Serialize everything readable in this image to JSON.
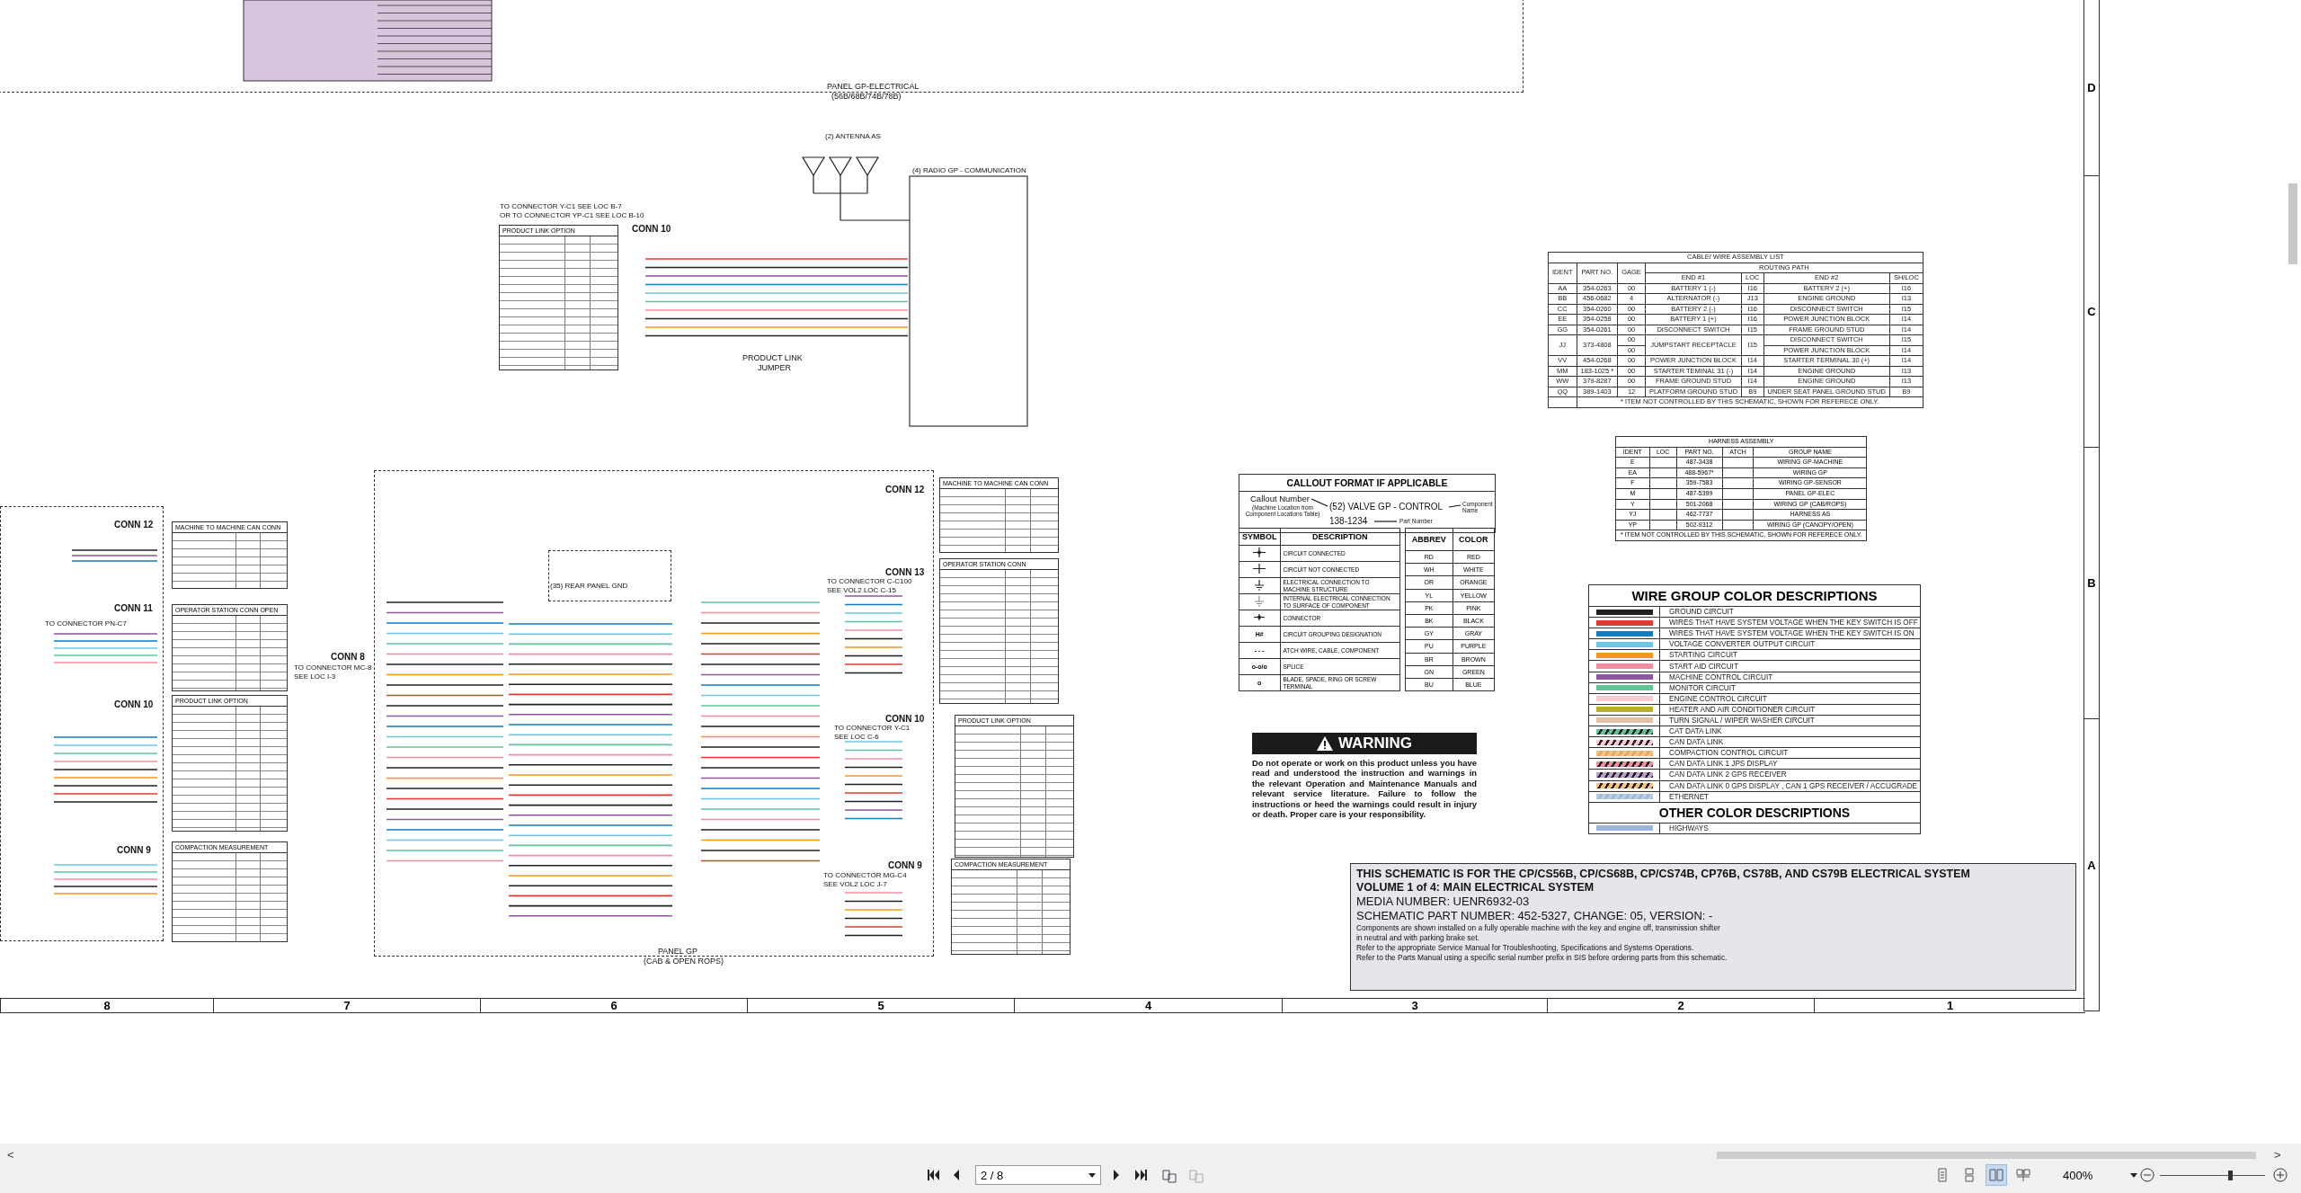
{
  "sheet": {
    "labels": [
      "PANEL GP-ELECTRICAL",
      "(56B/68B/74B/78B)",
      "(2) ANTENNA AS",
      "(4) RADIO GP - COMMUNICATION",
      "TO CONNECTOR Y-C1 SEE LOC B-7",
      "OR TO CONNECTOR YP-C1 SEE LOC B-10",
      "CONN 10",
      "PRODUCT LINK",
      "JUMPER",
      "CONN 12",
      "CONN 11",
      "TO CONNECTOR PN-C7",
      "CONN 10",
      "CONN 9",
      "CONN 8",
      "TO CONNECTOR MC-8",
      "SEE LOC I-3",
      "CONN 12",
      "CONN 13",
      "TO CONNECTOR C-C100",
      "SEE VOL2 LOC C-15",
      "CONN 10",
      "TO CONNECTOR Y-C1",
      "SEE LOC C-6",
      "CONN 9",
      "TO CONNECTOR MG-C4",
      "SEE VOL2 LOC J-7",
      "PANEL GP",
      "(CAB & OPEN ROPS)",
      "(35) REAR PANEL GND"
    ],
    "connector_tables": [
      "PRODUCT LINK OPTION",
      "MACHINE TO MACHINE CAN CONN",
      "OPERATOR STATION CONN OPEN",
      "PRODUCT LINK OPTION",
      "COMPACTION MEASUREMENT",
      "MACHINE TO MACHINE CAN CONN",
      "OPERATOR STATION CONN",
      "PRODUCT LINK OPTION",
      "COMPACTION MEASUREMENT"
    ],
    "row_letters": [
      "D",
      "C",
      "B",
      "A"
    ],
    "column_numbers": [
      "8",
      "7",
      "6",
      "5",
      "4",
      "3",
      "2",
      "1"
    ],
    "cable_list": {
      "title": "CABLE/ WIRE ASSEMBLY LIST",
      "columns": [
        "IDENT",
        "PART NO.",
        "GAGE"
      ],
      "group": "ROUTING PATH",
      "subcolumns": [
        "END #1",
        "LOC",
        "END #2",
        "SH/LOC"
      ],
      "rows": [
        {
          "kind": "full",
          "cells": [
            "AA",
            "354-0263",
            "00",
            "BATTERY 1 (-)",
            "I16",
            "BATTERY 2 (+)",
            "I16"
          ]
        },
        {
          "kind": "full",
          "cells": [
            "BB",
            "456-0682",
            "4",
            "ALTERNATOR (-)",
            "J13",
            "ENGINE GROUND",
            "I13"
          ]
        },
        {
          "kind": "full",
          "cells": [
            "CC",
            "354-0260",
            "00",
            "BATTERY 2 (-)",
            "I16",
            "DISCONNECT SWITCH",
            "I15"
          ]
        },
        {
          "kind": "full",
          "cells": [
            "EE",
            "354-0258",
            "00",
            "BATTERY 1 (+)",
            "I16",
            "POWER JUNCTION BLOCK",
            "I14"
          ]
        },
        {
          "kind": "full",
          "cells": [
            "GG",
            "354-0261",
            "00",
            "DISCONNECT SWITCH",
            "I15",
            "FRAME GROUND STUD",
            "I14"
          ]
        },
        {
          "kind": "full",
          "cells": [
            {
              "text": "JJ",
              "rowspan": 2
            },
            {
              "text": "373-4808",
              "rowspan": 2
            },
            "00",
            {
              "text": "JUMPSTART RECEPTACLE",
              "rowspan": 2
            },
            {
              "text": "I15",
              "rowspan": 2
            },
            "DISCONNECT SWITCH",
            "I15"
          ]
        },
        {
          "kind": "sub",
          "cells": [
            "00",
            "POWER JUNCTION BLOCK",
            "I14"
          ]
        },
        {
          "kind": "full",
          "cells": [
            "VV",
            "454-0268",
            "00",
            "POWER JUNCTION BLOCK",
            "I14",
            "STARTER TERMINAL 30 (+)",
            "I14"
          ]
        },
        {
          "kind": "full",
          "cells": [
            "MM",
            "183-1025 *",
            "00",
            "STARTER TEMINAL 31 (-)",
            "I14",
            "ENGINE GROUND",
            "I13"
          ]
        },
        {
          "kind": "full",
          "cells": [
            "WW",
            "379-8287",
            "00",
            "FRAME GROUND STUD",
            "I14",
            "ENGINE GROUND",
            "I13"
          ]
        },
        {
          "kind": "full",
          "cells": [
            "QQ",
            "389-1403",
            "12",
            "PLATFORM GROUND STUD",
            "B9",
            "UNDER SEAT PANEL GROUND STUD",
            "B9"
          ]
        }
      ],
      "footnote": "*  ITEM NOT CONTROLLED BY THIS SCHEMATIC, SHOWN FOR REFERECE ONLY."
    },
    "harness": {
      "title": "HARNESS ASSEMBLY",
      "columns": [
        "IDENT",
        "LOC",
        "PART NO.",
        "ATCH",
        "GROUP NAME"
      ],
      "rows": [
        [
          "E",
          "",
          "487-3438",
          "",
          "WIRING GP-MACHINE"
        ],
        [
          "EA",
          "",
          "488-5967*",
          "",
          "WIRING GP"
        ],
        [
          "F",
          "",
          "359-7583",
          "",
          "WIRING GP-SENSOR"
        ],
        [
          "M",
          "",
          "487-5399",
          "",
          "PANEL GP-ELEC"
        ],
        [
          "Y",
          "",
          "501-2068",
          "",
          "WIRING GP (CAB/ROPS)"
        ],
        [
          "YJ",
          "",
          "462-7737",
          "",
          "HARNESS AS"
        ],
        [
          "YP",
          "",
          "502-9312",
          "",
          "WIRING GP (CANOPY/OPEN)"
        ]
      ],
      "footnote": "*  ITEM NOT CONTROLLED BY THIS SCHEMATIC, SHOWN FOR REFERECE ONLY."
    },
    "callout": {
      "title": "CALLOUT FORMAT IF APPLICABLE",
      "callout_number": "Callout Number",
      "callout_hint": "(Machine Location from Component Locations Table)",
      "component": "(52) VALVE GP - CONTROL",
      "component_hint": "Component Name",
      "part": "138-1234",
      "part_hint": "Part Number"
    },
    "symbols": {
      "columns": [
        "SYMBOL",
        "DESCRIPTION"
      ],
      "rows": [
        {
          "kind": "dot-cross",
          "description": "CIRCUIT CONNECTED"
        },
        {
          "kind": "cross",
          "description": "CIRCUIT NOT CONNECTED"
        },
        {
          "kind": "ground",
          "description": "ELECTRICAL CONNECTION TO MACHINE STRUCTURE"
        },
        {
          "kind": "internal-ground",
          "description": "INTERNAL ELECTRICAL CONNECTION TO SURFACE OF COMPONENT"
        },
        {
          "kind": "connector",
          "description": "CONNECTOR"
        },
        {
          "kind": "text",
          "symbol": "H#",
          "description": "CIRCUIT GROUPING DESIGNATION"
        },
        {
          "kind": "text",
          "symbol": "- - -",
          "description": "ATCH WIRE, CABLE, COMPONENT"
        },
        {
          "kind": "text",
          "symbol": "o-o/o",
          "description": "SPLICE"
        },
        {
          "kind": "text",
          "symbol": "o",
          "description": "BLADE, SPADE, RING OR SCREW TERMINAL"
        }
      ]
    },
    "abbreviations": {
      "columns": [
        "ABBREV",
        "COLOR"
      ],
      "rows": [
        [
          "RD",
          "RED"
        ],
        [
          "WH",
          "WHITE"
        ],
        [
          "OR",
          "ORANGE"
        ],
        [
          "YL",
          "YELLOW"
        ],
        [
          "PK",
          "PINK"
        ],
        [
          "BK",
          "BLACK"
        ],
        [
          "GY",
          "GRAY"
        ],
        [
          "PU",
          "PURPLE"
        ],
        [
          "BR",
          "BROWN"
        ],
        [
          "GN",
          "GREEN"
        ],
        [
          "BU",
          "BLUE"
        ]
      ]
    },
    "warning": {
      "title": "WARNING",
      "text": "Do not operate or work on this product unless you have read and understood the instruction and warnings in the relevant Operation and Maintenance Manuals and relevant service literature. Failure to follow the instructions or heed the warnings could result in injury or death. Proper care is your responsibility."
    },
    "wire_groups": {
      "title": "WIRE GROUP COLOR DESCRIPTIONS",
      "items": [
        {
          "kind": "solid",
          "color": "#231f20",
          "label": "GROUND CIRCUIT"
        },
        {
          "kind": "solid",
          "color": "#e8392f",
          "label": "WIRES THAT HAVE SYSTEM VOLTAGE WHEN THE KEY SWITCH IS OFF"
        },
        {
          "kind": "solid",
          "color": "#0f7dc2",
          "label": "WIRES THAT HAVE SYSTEM VOLTAGE WHEN THE KEY SWITCH IS ON"
        },
        {
          "kind": "solid",
          "color": "#6cc5e6",
          "label": "VOLTAGE CONVERTER OUTPUT CIRCUIT"
        },
        {
          "kind": "solid",
          "color": "#f7941d",
          "label": "STARTING CIRCUIT"
        },
        {
          "kind": "solid",
          "color": "#f08ca0",
          "label": "START AID CIRCUIT"
        },
        {
          "kind": "solid",
          "color": "#8e55a0",
          "label": "MACHINE CONTROL CIRCUIT"
        },
        {
          "kind": "solid",
          "color": "#5fc396",
          "label": "MONITOR CIRCUIT"
        },
        {
          "kind": "solid",
          "color": "#f9c9d3",
          "label": "ENGINE CONTROL CIRCUIT"
        },
        {
          "kind": "solid",
          "color": "#bcb31a",
          "label": "HEATER AND AIR CONDITIONER CIRCUIT"
        },
        {
          "kind": "solid",
          "color": "#e3c0a3",
          "label": "TURN SIGNAL / WIPER WASHER CIRCUIT"
        },
        {
          "kind": "striped",
          "color": "#5fc396",
          "label": "CAT DATA LINK"
        },
        {
          "kind": "striped",
          "color": "#f9c9d3",
          "label": "CAN DATA LINK"
        },
        {
          "kind": "striped-light",
          "color": "#f9c27a",
          "label": "COMPACTION CONTROL CIRCUIT"
        },
        {
          "kind": "striped",
          "color": "#f08ca0",
          "label": "CAN DATA LINK 1 JPS DISPLAY"
        },
        {
          "kind": "striped",
          "color": "#b9a0cf",
          "label": "CAN DATA LINK 2 GPS RECEIVER"
        },
        {
          "kind": "striped",
          "color": "#f9c27a",
          "label": "CAN DATA LINK 0 GPS DISPLAY , CAN 1 GPS RECEIVER / ACCUGRADE"
        },
        {
          "kind": "striped-light",
          "color": "#b7cfe6",
          "label": "ETHERNET"
        }
      ],
      "other_title": "OTHER COLOR DESCRIPTIONS",
      "other_items": [
        {
          "kind": "solid",
          "color": "#9db3d8",
          "label": "HIGHWAYS"
        }
      ]
    },
    "title_block": {
      "heading": "THIS SCHEMATIC IS FOR THE CP/CS56B, CP/CS68B, CP/CS74B, CP76B, CS78B, AND CS79B ELECTRICAL SYSTEM",
      "volume": "VOLUME 1 of 4: MAIN ELECTRICAL SYSTEM",
      "media": "MEDIA NUMBER: UENR6932-03",
      "part": "SCHEMATIC PART NUMBER: 452-5327, CHANGE: 05, VERSION: -",
      "notes": [
        "Components are shown installed on a fully operable machine with the key and engine off, transmission shifter",
        "in neutral and with parking brake set.",
        "Refer to the appropriate Service Manual for Troubleshooting, Specifications and Systems Operations.",
        "Refer to the Parts Manual using a specific serial number prefix in SIS before ordering parts from this schematic."
      ]
    }
  },
  "viewer": {
    "scroll_left": "<",
    "scroll_right": ">",
    "page": "2 / 8",
    "zoom": "400%",
    "zoom_slider": {
      "level": 0.67
    },
    "view_modes": [
      {
        "selected": false
      },
      {
        "selected": false
      },
      {
        "selected": true
      },
      {
        "selected": false
      }
    ]
  }
}
